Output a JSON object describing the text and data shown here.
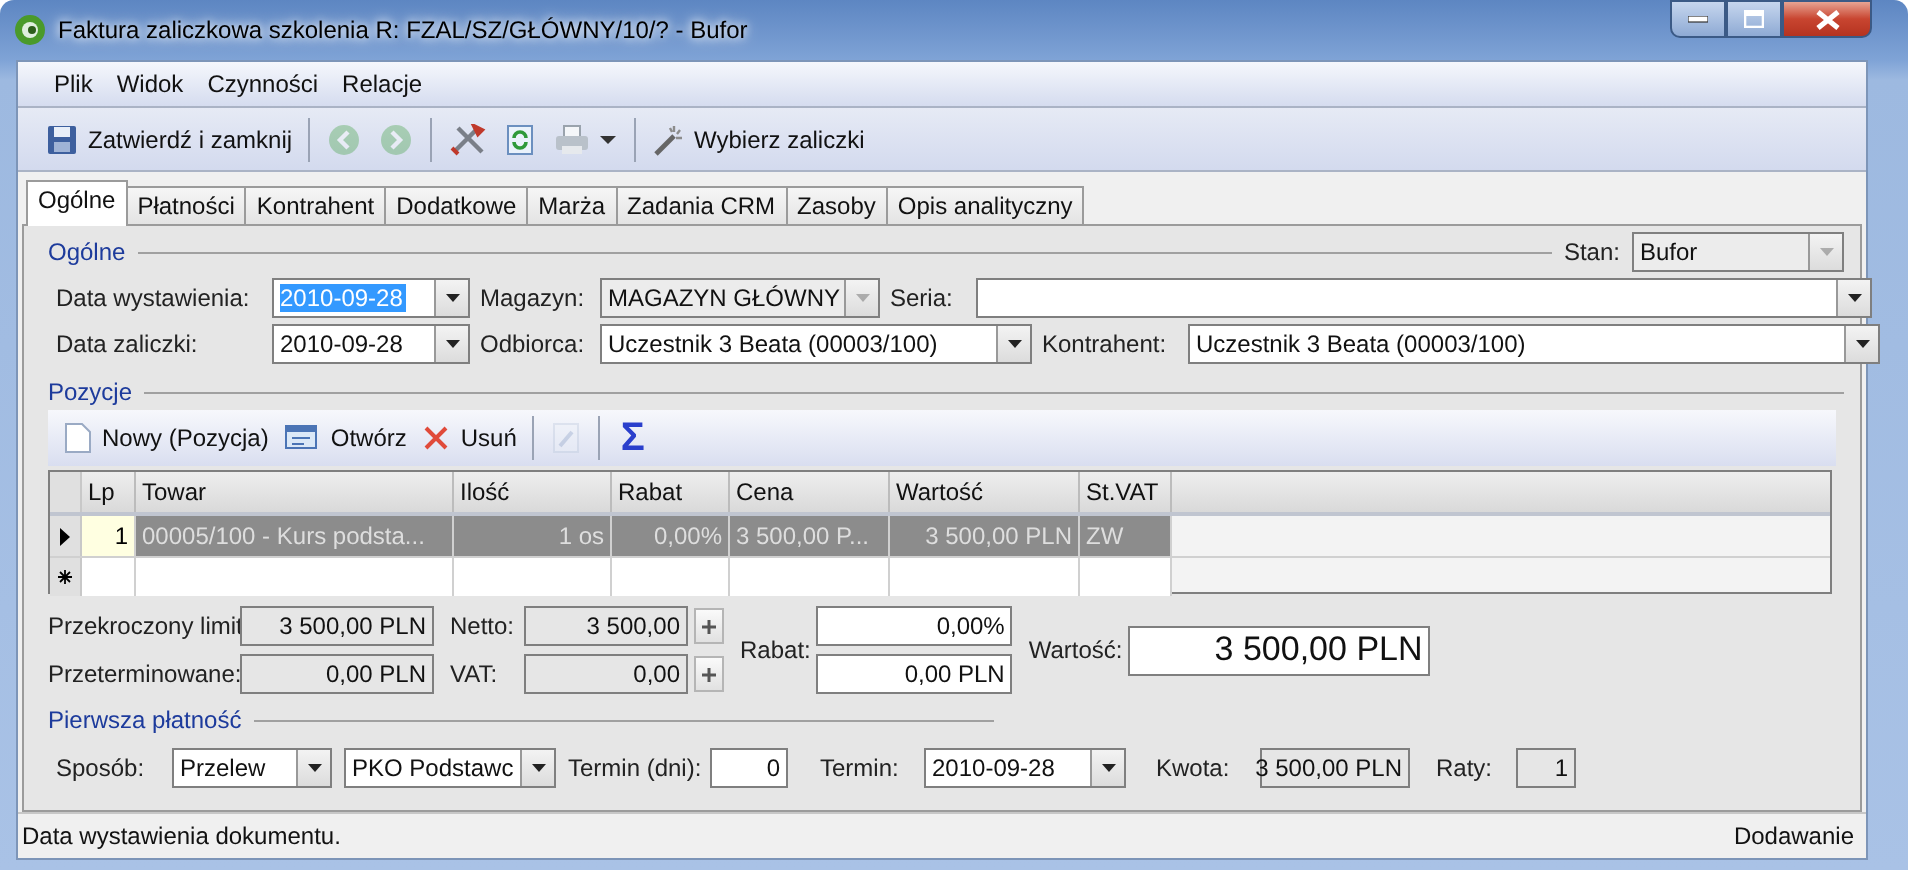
{
  "window": {
    "title": "Faktura zaliczkowa szkolenia R: FZAL/SZ/GŁÓWNY/10/? - Bufor"
  },
  "menu": [
    "Plik",
    "Widok",
    "Czynności",
    "Relacje"
  ],
  "toolbar": {
    "save_label": "Zatwierdź i zamknij",
    "back": {
      "disabled": true
    },
    "forward": {
      "disabled": true
    },
    "select_label": "Wybierz zaliczki"
  },
  "tabs": [
    {
      "label": "Ogólne",
      "selected": true
    },
    {
      "label": "Płatności",
      "selected": false
    },
    {
      "label": "Kontrahent",
      "selected": false
    },
    {
      "label": "Dodatkowe",
      "selected": false
    },
    {
      "label": "Marża",
      "selected": false
    },
    {
      "label": "Zadania CRM",
      "selected": false
    },
    {
      "label": "Zasoby",
      "selected": false
    },
    {
      "label": "Opis analityczny",
      "selected": false
    }
  ],
  "general": {
    "legend": "Ogólne",
    "state": {
      "label": "Stan:",
      "value": "Bufor",
      "disabled": true
    },
    "issue_date": {
      "label": "Data wystawienia:",
      "value": "2010-09-28",
      "text_selected": true
    },
    "warehouse": {
      "label": "Magazyn:",
      "value": "MAGAZYN GŁÓWNY",
      "disabled": true
    },
    "series": {
      "label": "Seria:"
    },
    "advance_date": {
      "label": "Data zaliczki:",
      "value": "2010-09-28",
      "text_selected": false
    },
    "recipient": {
      "label": "Odbiorca:",
      "value": "Uczestnik 3 Beata (00003/100)"
    },
    "contractor": {
      "label": "Kontrahent:",
      "value": "Uczestnik 3 Beata (00003/100)"
    }
  },
  "positions": {
    "legend": "Pozycje",
    "new_label": "Nowy (Pozycja)",
    "open_label": "Otwórz",
    "delete_label": "Usuń",
    "edit": {
      "disabled": true
    },
    "sum_label": "Σ",
    "table": {
      "columns": [
        "Lp",
        "Towar",
        "Ilość",
        "Rabat",
        "Cena",
        "Wartość",
        "St.VAT"
      ],
      "rows": [
        {
          "selected": true,
          "cells": [
            "1",
            "00005/100 - Kurs podsta...",
            "1 os",
            "0,00%",
            "3 500,00 P...",
            "3 500,00 PLN",
            "ZW"
          ]
        }
      ]
    }
  },
  "summary": {
    "limit": {
      "label": "Przekroczony limit",
      "value": "3 500,00 PLN"
    },
    "overdue": {
      "label": "Przeterminowane:",
      "value": "0,00 PLN"
    },
    "net": {
      "label": "Netto:",
      "value": "3 500,00"
    },
    "vat": {
      "label": "VAT:",
      "value": "0,00"
    },
    "discount": {
      "label": "Rabat:",
      "percent": "0,00%",
      "amount": "0,00 PLN"
    },
    "total": {
      "label": "Wartość:",
      "value": "3 500,00 PLN"
    }
  },
  "first_payment": {
    "legend": "Pierwsza płatność",
    "method": {
      "label": "Sposób:",
      "value": "Przelew"
    },
    "bank": {
      "value": "PKO Podstawc"
    },
    "term_days": {
      "label": "Termin (dni):",
      "value": "0"
    },
    "due_date": {
      "label": "Termin:",
      "value": "2010-09-28"
    },
    "amount": {
      "label": "Kwota:",
      "value": "3 500,00 PLN"
    },
    "installments": {
      "label": "Raty:",
      "value": "1"
    }
  },
  "status_bar": {
    "hint": "Data wystawienia dokumentu.",
    "mode": "Dodawanie"
  }
}
